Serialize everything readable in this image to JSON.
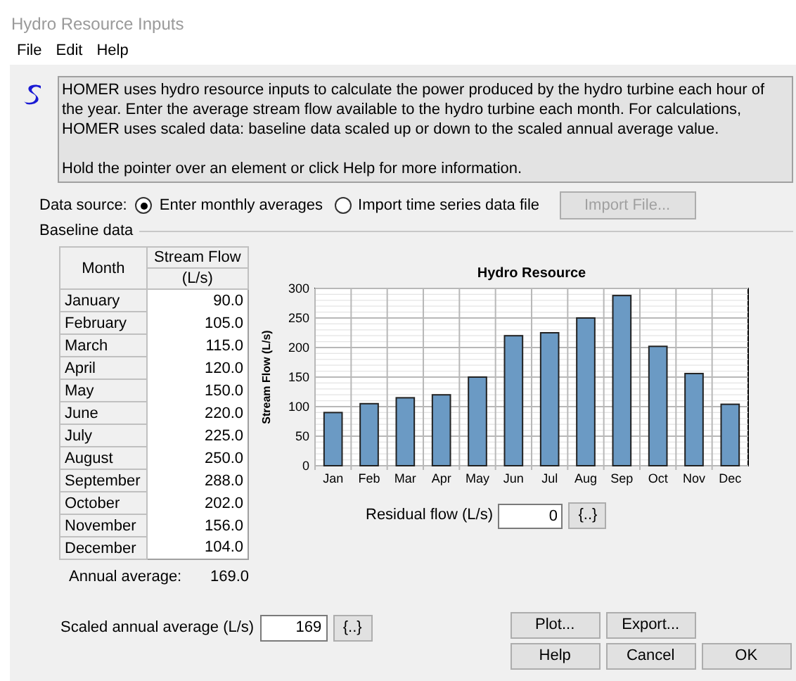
{
  "window": {
    "title": "Hydro Resource Inputs"
  },
  "menu": [
    "File",
    "Edit",
    "Help"
  ],
  "description": [
    "HOMER uses hydro resource inputs to calculate the power produced by the hydro turbine each hour of the year. Enter the average stream flow available to the hydro turbine each month. For calculations, HOMER uses scaled data: baseline data scaled up or down to the scaled annual average value.",
    "Hold the pointer over an element or click Help for more information."
  ],
  "data_source": {
    "label": "Data source:",
    "options": [
      {
        "label": "Enter monthly averages",
        "selected": true
      },
      {
        "label": "Import time series data file",
        "selected": false
      }
    ],
    "import_button": {
      "label": "Import File...",
      "disabled": true
    }
  },
  "baseline": {
    "title": "Baseline data",
    "table": {
      "columns": [
        "Month",
        "Stream Flow",
        "(L/s)"
      ],
      "rows": [
        {
          "month": "January",
          "flow": "90.0"
        },
        {
          "month": "February",
          "flow": "105.0"
        },
        {
          "month": "March",
          "flow": "115.0"
        },
        {
          "month": "April",
          "flow": "120.0"
        },
        {
          "month": "May",
          "flow": "150.0"
        },
        {
          "month": "June",
          "flow": "220.0"
        },
        {
          "month": "July",
          "flow": "225.0"
        },
        {
          "month": "August",
          "flow": "250.0"
        },
        {
          "month": "September",
          "flow": "288.0"
        },
        {
          "month": "October",
          "flow": "202.0"
        },
        {
          "month": "November",
          "flow": "156.0"
        },
        {
          "month": "December",
          "flow": "104.0"
        }
      ]
    },
    "annual_average": {
      "label": "Annual average:",
      "value": "169.0"
    },
    "chart_data": {
      "type": "bar",
      "title": "Hydro Resource",
      "ylabel": "Stream Flow (L/s)",
      "categories": [
        "Jan",
        "Feb",
        "Mar",
        "Apr",
        "May",
        "Jun",
        "Jul",
        "Aug",
        "Sep",
        "Oct",
        "Nov",
        "Dec"
      ],
      "grid": true,
      "series": [
        {
          "color": "#6b9ac4",
          "values": [
            90,
            105,
            115,
            120,
            150,
            220,
            225,
            250,
            288,
            202,
            156,
            104
          ]
        }
      ],
      "ylim": [
        0,
        300
      ],
      "yticks": [
        0,
        50,
        100,
        150,
        200,
        250,
        300
      ]
    },
    "residual_flow": {
      "label": "Residual flow (L/s)",
      "value": "0",
      "button": "{..}"
    }
  },
  "scaled_average": {
    "label": "Scaled annual average (L/s)",
    "value": "169",
    "button": "{..}"
  },
  "buttons": [
    {
      "label": "Plot..."
    },
    {
      "label": "Export..."
    },
    {
      "label": "Help"
    },
    {
      "label": "Cancel"
    },
    {
      "label": "OK"
    }
  ]
}
